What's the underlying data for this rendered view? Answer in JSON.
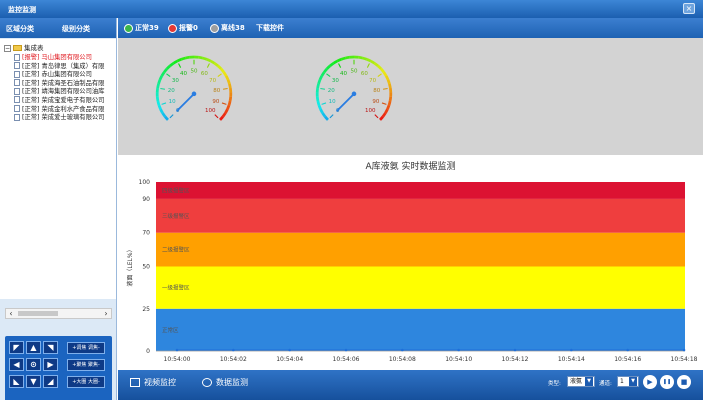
{
  "window": {
    "title": "监控监测",
    "close_glyph": "×"
  },
  "left_tabs": {
    "region": "区域分类",
    "level": "级别分类"
  },
  "tree": {
    "root_label": "集成表",
    "items": [
      {
        "label": "[报警] 马山集团有限公司",
        "status": "alarm"
      },
      {
        "label": "[正常] 青岛律思（集成）有限",
        "status": "normal"
      },
      {
        "label": "[正常] 赤山集团有限公司",
        "status": "normal"
      },
      {
        "label": "[正常] 荣成海圣石油制品有限",
        "status": "normal"
      },
      {
        "label": "[正常] 靖海集团有限公司油库",
        "status": "normal"
      },
      {
        "label": "[正常] 荣成宝爱电子有限公司",
        "status": "normal"
      },
      {
        "label": "[正常] 荣成金利水产食品有限",
        "status": "normal"
      },
      {
        "label": "[正常] 荣成爱士玻璃有限公司",
        "status": "normal"
      }
    ]
  },
  "ptz": {
    "arrows": {
      "up_left": "◤",
      "up": "▲",
      "up_right": "◥",
      "left": "◀",
      "center": "⊙",
      "right": "▶",
      "down_left": "◣",
      "down": "▼",
      "down_right": "◢"
    },
    "pills": [
      "+调焦  调焦-",
      "+聚焦  聚焦-",
      "+大圈  大圈-"
    ],
    "zoom_minus": "−",
    "zoom_plus": "+"
  },
  "status_bar": {
    "normal": {
      "label": "正常39",
      "color": "#3ab54a"
    },
    "alarm": {
      "label": "报警0",
      "color": "#e53935"
    },
    "offline": {
      "label": "离线38",
      "color": "#9e9e9e"
    },
    "download": "下载控件"
  },
  "gauges": [
    {
      "value": 0,
      "ticks": [
        "0",
        "10",
        "20",
        "30",
        "40",
        "50",
        "60",
        "70",
        "80",
        "90",
        "100"
      ]
    },
    {
      "value": 0,
      "ticks": [
        "0",
        "10",
        "20",
        "30",
        "40",
        "50",
        "60",
        "70",
        "80",
        "90",
        "100"
      ]
    }
  ],
  "chart_data": {
    "type": "area",
    "title": "A库液氨 实时数据监测",
    "ylabel": "液面（LEL%）",
    "ylim": [
      0,
      100
    ],
    "yticks": [
      0,
      25,
      50,
      70,
      90,
      100
    ],
    "x": [
      "10:54:00",
      "10:54:02",
      "10:54:04",
      "10:54:06",
      "10:54:08",
      "10:54:10",
      "10:54:12",
      "10:54:14",
      "10:54:16",
      "10:54:18"
    ],
    "series": [
      {
        "values": [
          0,
          0,
          0,
          0,
          0,
          0,
          0,
          0,
          0,
          0
        ]
      }
    ],
    "bands": [
      {
        "from": 0,
        "to": 25,
        "label": "正常区",
        "color": "#2e86de"
      },
      {
        "from": 25,
        "to": 50,
        "label": "一级报警区",
        "color": "#ffff00"
      },
      {
        "from": 50,
        "to": 70,
        "label": "二级报警区",
        "color": "#ffa000"
      },
      {
        "from": 70,
        "to": 90,
        "label": "三级报警区",
        "color": "#ef3e3e"
      },
      {
        "from": 90,
        "to": 100,
        "label": "四级报警区",
        "color": "#dc1232"
      }
    ],
    "grid": false,
    "legend": "none"
  },
  "bottom": {
    "video_tab": "视频监控",
    "data_tab": "数据监测",
    "type_label": "类型:",
    "type_value": "液氨",
    "index_label": "通道:",
    "index_value": "1",
    "buttons": {
      "play": "▶",
      "pause": "❚❚",
      "stop": "■",
      "record": "●"
    }
  }
}
